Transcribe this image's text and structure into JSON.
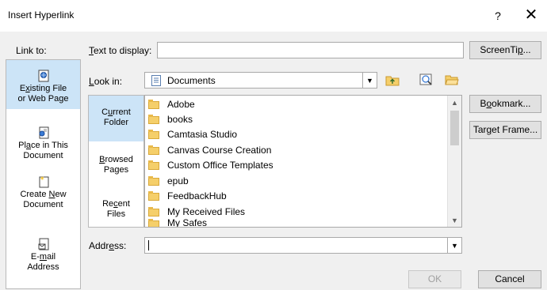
{
  "window": {
    "title": "Insert Hyperlink",
    "help_label": "?",
    "close_label": "✕"
  },
  "link_to": {
    "label": "Link to:",
    "items": [
      {
        "line1_pre": "E",
        "line1_ul": "x",
        "line1_post": "isting File",
        "line2": "or Web Page"
      },
      {
        "line1_pre": "Pl",
        "line1_ul": "a",
        "line1_post": "ce in This",
        "line2": "Document"
      },
      {
        "line1": "Create ",
        "line1_ul": "N",
        "line1_post": "ew",
        "line2": "Document"
      },
      {
        "line1_pre": "E-",
        "line1_ul": "m",
        "line1_post": "ail",
        "line2": "Address"
      }
    ]
  },
  "text_to_display": {
    "label_ul": "T",
    "label_rest": "ext to display:",
    "value": ""
  },
  "screentip_button": {
    "pre": "ScreenTi",
    "ul": "p",
    "post": "..."
  },
  "look_in": {
    "label_ul": "L",
    "label_rest": "ook in:",
    "value": "Documents"
  },
  "folder_bar": {
    "items": [
      {
        "l1_pre": "C",
        "l1_ul": "u",
        "l1_post": "rrent",
        "l2": "Folder"
      },
      {
        "l1_ul": "B",
        "l1_post": "rowsed",
        "l2": "Pages"
      },
      {
        "l1_pre": "Re",
        "l1_ul": "c",
        "l1_post": "ent",
        "l2": "Files"
      }
    ]
  },
  "files": [
    "Adobe",
    "books",
    "Camtasia Studio",
    "Canvas Course Creation",
    "Custom Office Templates",
    "epub",
    "FeedbackHub",
    "My Received Files",
    "My Safes"
  ],
  "bookmark_button": {
    "pre": "B",
    "ul": "o",
    "post": "okmark..."
  },
  "target_frame_button": {
    "pre": "Tar",
    "ul": "g",
    "post": "et Frame..."
  },
  "address": {
    "label_pre": "Addr",
    "label_ul": "e",
    "label_post": "ss:",
    "value": ""
  },
  "ok_label": "OK",
  "cancel_label": "Cancel",
  "colors": {
    "selection": "#cce4f7",
    "folder": "#f5cf6a"
  }
}
